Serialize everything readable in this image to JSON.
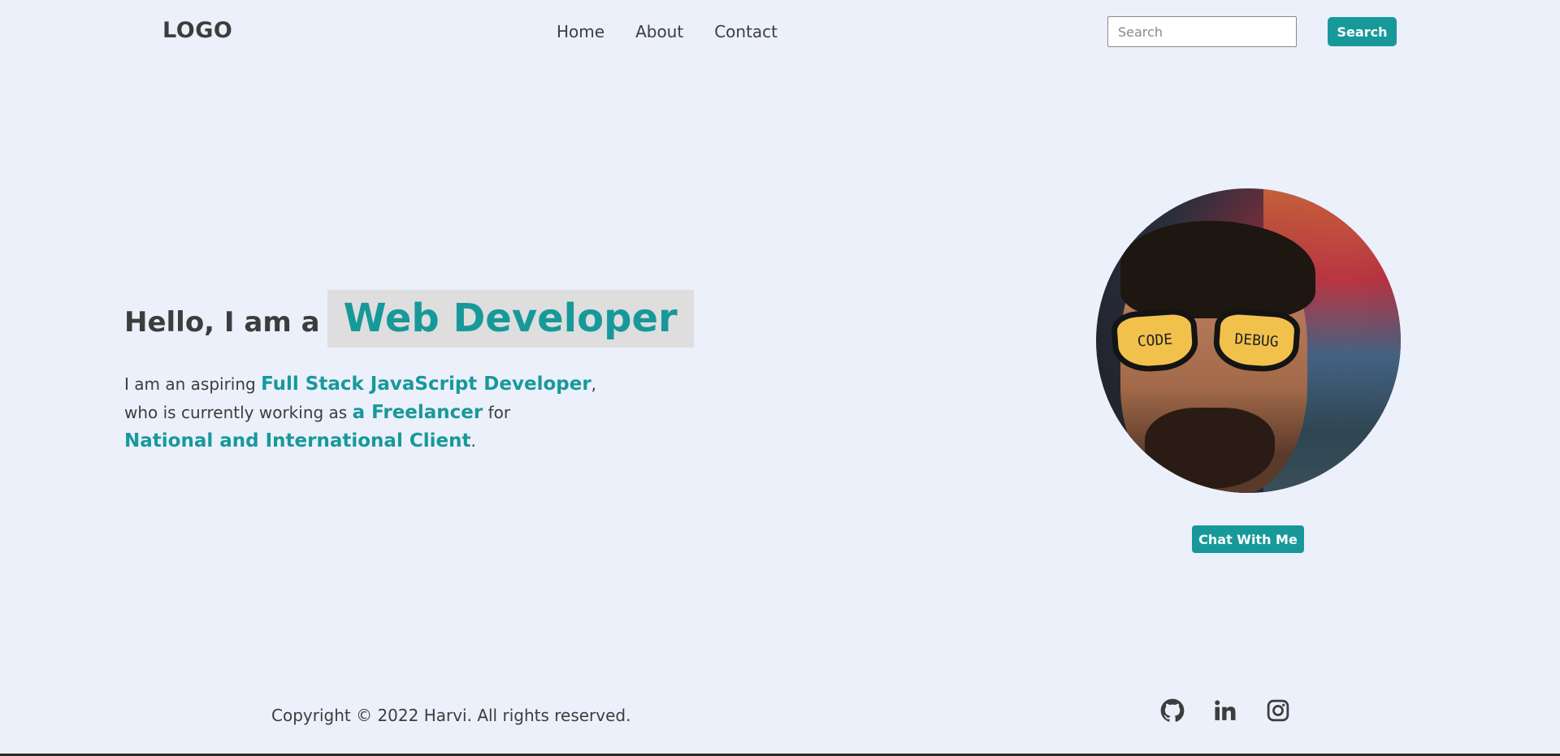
{
  "header": {
    "logo": "LOGO",
    "nav": [
      {
        "label": "Home"
      },
      {
        "label": "About"
      },
      {
        "label": "Contact"
      }
    ],
    "search": {
      "placeholder": "Search",
      "value": "",
      "button_label": "Search"
    }
  },
  "hero": {
    "greeting_prefix": "Hello, I am a",
    "greeting_role": "Web Developer",
    "intro": {
      "part1": "I am an aspiring ",
      "highlight1": "Full Stack JavaScript Developer",
      "part2": ",",
      "part3": "who is currently working as ",
      "highlight2": "a Freelancer",
      "part4": " for",
      "highlight3": "National and International Client",
      "part5": "."
    },
    "portrait": {
      "lens_left_text": "CODE",
      "lens_right_text": "DEBUG"
    },
    "chat_button_label": "Chat With Me"
  },
  "footer": {
    "copyright": "Copyright © 2022 Harvi. All rights reserved.",
    "social_icons": [
      "github-icon",
      "linkedin-icon",
      "instagram-icon"
    ]
  },
  "colors": {
    "background": "#ecf0fb",
    "accent": "#17999a",
    "text": "#3d3d3d",
    "highlight_bg": "#dedede"
  }
}
